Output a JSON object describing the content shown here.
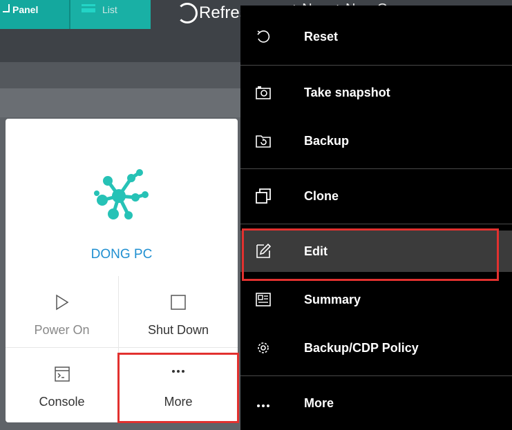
{
  "toolbar": {
    "panel_label": "Panel",
    "list_label": "List",
    "refresh_label": "Refresh",
    "extra_text": "+  New    +  New Gr"
  },
  "vm_card": {
    "name": "DONG PC",
    "actions": [
      {
        "label": "Power On",
        "icon": "play-icon",
        "enabled": false
      },
      {
        "label": "Shut Down",
        "icon": "stop-square-icon",
        "enabled": true
      },
      {
        "label": "Console",
        "icon": "console-icon",
        "enabled": true
      },
      {
        "label": "More",
        "icon": "ellipsis-icon",
        "enabled": true
      }
    ],
    "accent_color": "#26c2b6",
    "name_color": "#1f8fd1"
  },
  "menu": {
    "items": [
      {
        "label": "Reset",
        "icon": "reset-icon"
      },
      {
        "label": "Take snapshot",
        "icon": "camera-icon"
      },
      {
        "label": "Backup",
        "icon": "backup-icon"
      },
      {
        "label": "Clone",
        "icon": "clone-icon"
      },
      {
        "label": "Edit",
        "icon": "edit-icon",
        "active": true
      },
      {
        "label": "Summary",
        "icon": "summary-icon"
      },
      {
        "label": "Backup/CDP Policy",
        "icon": "gear-icon"
      },
      {
        "label": "More",
        "icon": "ellipsis-icon"
      }
    ]
  },
  "highlight_color": "#e2312f"
}
